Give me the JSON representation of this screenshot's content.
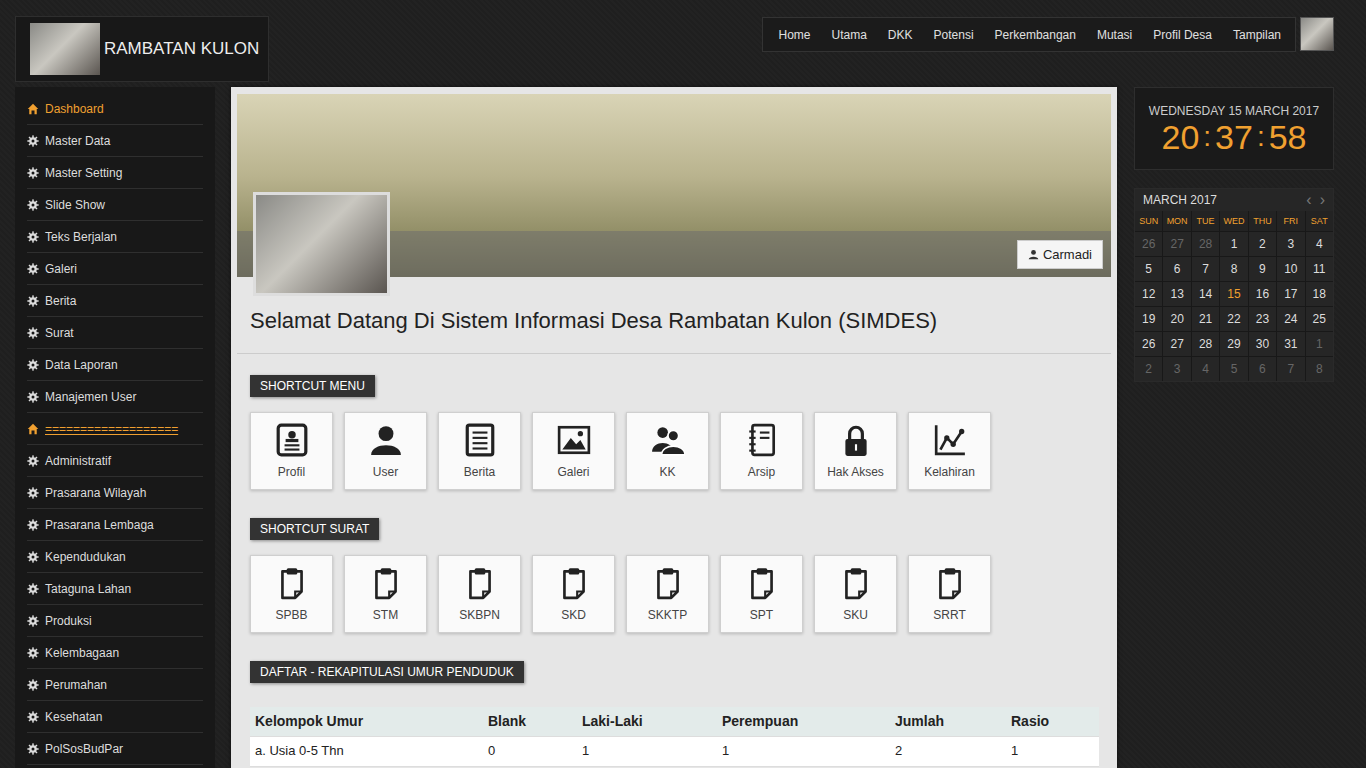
{
  "header": {
    "site_title": "RAMBATAN KULON"
  },
  "nav": [
    "Home",
    "Utama",
    "DKK",
    "Potensi",
    "Perkembangan",
    "Mutasi",
    "Profil Desa",
    "Tampilan"
  ],
  "sidebar": {
    "items": [
      {
        "label": "Dashboard",
        "kind": "home",
        "selected": true
      },
      {
        "label": "Master Data",
        "kind": "link",
        "selected": false
      },
      {
        "label": "Master Setting",
        "kind": "link",
        "selected": false
      },
      {
        "label": "Slide Show",
        "kind": "link",
        "selected": false
      },
      {
        "label": "Teks Berjalan",
        "kind": "link",
        "selected": false
      },
      {
        "label": "Galeri",
        "kind": "link",
        "selected": false
      },
      {
        "label": "Berita",
        "kind": "link",
        "selected": false
      },
      {
        "label": "Surat",
        "kind": "link",
        "selected": false
      },
      {
        "label": "Data Laporan",
        "kind": "link",
        "selected": false
      },
      {
        "label": "Manajemen User",
        "kind": "link",
        "selected": false
      },
      {
        "label": "===================",
        "kind": "divider",
        "selected": false
      },
      {
        "label": "Administratif",
        "kind": "link",
        "selected": false
      },
      {
        "label": "Prasarana Wilayah",
        "kind": "link",
        "selected": false
      },
      {
        "label": "Prasarana Lembaga",
        "kind": "link",
        "selected": false
      },
      {
        "label": "Kependudukan",
        "kind": "link",
        "selected": false
      },
      {
        "label": "Tataguna Lahan",
        "kind": "link",
        "selected": false
      },
      {
        "label": "Produksi",
        "kind": "link",
        "selected": false
      },
      {
        "label": "Kelembagaan",
        "kind": "link",
        "selected": false
      },
      {
        "label": "Perumahan",
        "kind": "link",
        "selected": false
      },
      {
        "label": "Kesehatan",
        "kind": "link",
        "selected": false
      },
      {
        "label": "PolSosBudPar",
        "kind": "link",
        "selected": false
      }
    ]
  },
  "user": {
    "name": "Carmadi"
  },
  "welcome": "Selamat Datang Di Sistem Informasi Desa Rambatan Kulon (SIMDES)",
  "shortcut_menu": {
    "title": "SHORTCUT MENU",
    "items": [
      {
        "label": "Profil",
        "kind": "profile"
      },
      {
        "label": "User",
        "kind": "user"
      },
      {
        "label": "Berita",
        "kind": "news"
      },
      {
        "label": "Galeri",
        "kind": "gallery"
      },
      {
        "label": "KK",
        "kind": "family"
      },
      {
        "label": "Arsip",
        "kind": "archive"
      },
      {
        "label": "Hak Akses",
        "kind": "lock"
      },
      {
        "label": "Kelahiran",
        "kind": "chart"
      }
    ]
  },
  "shortcut_surat": {
    "title": "SHORTCUT SURAT",
    "items": [
      "SPBB",
      "STM",
      "SKBPN",
      "SKD",
      "SKKTP",
      "SPT",
      "SKU",
      "SRRT"
    ]
  },
  "table": {
    "title": "DAFTAR - REKAPITULASI UMUR PENDUDUK",
    "columns": [
      "Kelompok Umur",
      "Blank",
      "Laki-Laki",
      "Perempuan",
      "Jumlah",
      "Rasio"
    ],
    "rows": [
      [
        "a. Usia 0-5 Thn",
        "0",
        "1",
        "1",
        "2",
        "1"
      ]
    ]
  },
  "clock": {
    "date": "WEDNESDAY 15 MARCH 2017",
    "time": [
      "20",
      "37",
      "58"
    ],
    "separator": ":"
  },
  "calendar": {
    "title": "MARCH 2017",
    "prev": "‹",
    "next": "›",
    "weekdays": [
      "SUN",
      "MON",
      "TUE",
      "WED",
      "THU",
      "FRI",
      "SAT"
    ],
    "weeks": [
      [
        {
          "day": "26",
          "muted": true,
          "selected": false
        },
        {
          "day": "27",
          "muted": true,
          "selected": false
        },
        {
          "day": "28",
          "muted": true,
          "selected": false
        },
        {
          "day": "1",
          "muted": false,
          "selected": false
        },
        {
          "day": "2",
          "muted": false,
          "selected": false
        },
        {
          "day": "3",
          "muted": false,
          "selected": false
        },
        {
          "day": "4",
          "muted": false,
          "selected": false
        }
      ],
      [
        {
          "day": "5",
          "muted": false,
          "selected": false
        },
        {
          "day": "6",
          "muted": false,
          "selected": false
        },
        {
          "day": "7",
          "muted": false,
          "selected": false
        },
        {
          "day": "8",
          "muted": false,
          "selected": false
        },
        {
          "day": "9",
          "muted": false,
          "selected": false
        },
        {
          "day": "10",
          "muted": false,
          "selected": false
        },
        {
          "day": "11",
          "muted": false,
          "selected": false
        }
      ],
      [
        {
          "day": "12",
          "muted": false,
          "selected": false
        },
        {
          "day": "13",
          "muted": false,
          "selected": false
        },
        {
          "day": "14",
          "muted": false,
          "selected": false
        },
        {
          "day": "15",
          "muted": false,
          "selected": true
        },
        {
          "day": "16",
          "muted": false,
          "selected": false
        },
        {
          "day": "17",
          "muted": false,
          "selected": false
        },
        {
          "day": "18",
          "muted": false,
          "selected": false
        }
      ],
      [
        {
          "day": "19",
          "muted": false,
          "selected": false
        },
        {
          "day": "20",
          "muted": false,
          "selected": false
        },
        {
          "day": "21",
          "muted": false,
          "selected": false
        },
        {
          "day": "22",
          "muted": false,
          "selected": false
        },
        {
          "day": "23",
          "muted": false,
          "selected": false
        },
        {
          "day": "24",
          "muted": false,
          "selected": false
        },
        {
          "day": "25",
          "muted": false,
          "selected": false
        }
      ],
      [
        {
          "day": "26",
          "muted": false,
          "selected": false
        },
        {
          "day": "27",
          "muted": false,
          "selected": false
        },
        {
          "day": "28",
          "muted": false,
          "selected": false
        },
        {
          "day": "29",
          "muted": false,
          "selected": false
        },
        {
          "day": "30",
          "muted": false,
          "selected": false
        },
        {
          "day": "31",
          "muted": false,
          "selected": false
        },
        {
          "day": "1",
          "muted": true,
          "selected": false
        }
      ],
      [
        {
          "day": "2",
          "muted": true,
          "selected": false
        },
        {
          "day": "3",
          "muted": true,
          "selected": false
        },
        {
          "day": "4",
          "muted": true,
          "selected": false
        },
        {
          "day": "5",
          "muted": true,
          "selected": false
        },
        {
          "day": "6",
          "muted": true,
          "selected": false
        },
        {
          "day": "7",
          "muted": true,
          "selected": false
        },
        {
          "day": "8",
          "muted": true,
          "selected": false
        }
      ]
    ]
  }
}
